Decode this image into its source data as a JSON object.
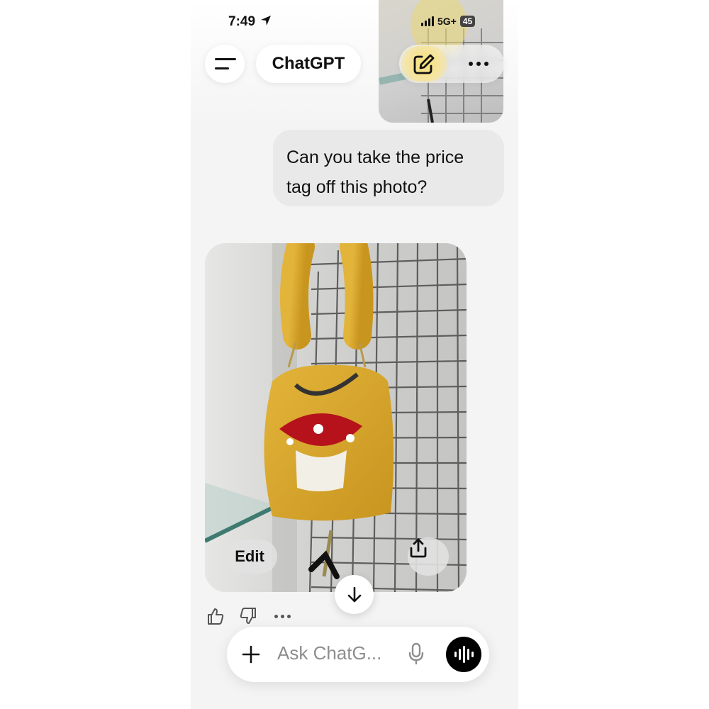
{
  "status_bar": {
    "time": "7:49",
    "network": "5G+",
    "battery": "45"
  },
  "header": {
    "title": "ChatGPT",
    "menu_icon": "hamburger-icon",
    "new_chat_icon": "compose-icon",
    "more_icon": "more-dots-icon"
  },
  "conversation": {
    "user_message_lines": [
      "Can you take the price",
      "tag off this photo?"
    ],
    "generated_image": {
      "edit_label": "Edit",
      "share_icon": "share-icon"
    },
    "response_actions": [
      "thumbs-up-icon",
      "thumbs-down-icon",
      "more-dots-icon"
    ],
    "scroll_icon": "arrow-down-icon"
  },
  "composer": {
    "placeholder": "Ask ChatG...",
    "plus_icon": "plus-icon",
    "mic_icon": "mic-icon",
    "voice_icon": "voice-mode-icon"
  },
  "colors": {
    "background": "#f4f4f4",
    "bubble": "#e9e9e9",
    "bag_yellow": "#d9a72a",
    "mushroom_red": "#b5121b"
  }
}
